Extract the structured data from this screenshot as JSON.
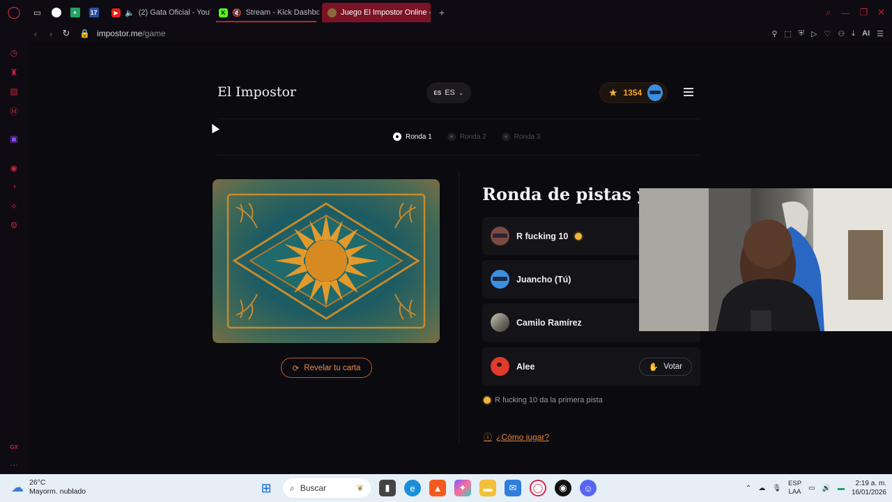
{
  "browser": {
    "tabs": [
      {
        "label": "(2) Gata Oficial - YouTu",
        "icon": "youtube-icon"
      },
      {
        "label": "Stream - Kick Dashboa",
        "icon": "kick-icon"
      },
      {
        "label": "Juego El Impostor Online -",
        "icon": "impostor-icon",
        "active": true
      }
    ],
    "url_host": "impostor.me",
    "url_path": "/game",
    "ai_label": "AI"
  },
  "site": {
    "title": "El Impostor",
    "lang_small": "ES",
    "lang": "ES",
    "score": "1354"
  },
  "rounds": [
    {
      "label": "Ronda 1",
      "active": true
    },
    {
      "label": "Ronda 2",
      "active": false
    },
    {
      "label": "Ronda 3",
      "active": false
    }
  ],
  "card": {
    "reveal_label": "Revelar tu carta"
  },
  "game": {
    "section_title": "Ronda de pistas y v",
    "players": [
      {
        "name": "R fucking 10",
        "avatar": "brown",
        "badge": true
      },
      {
        "name": "Juancho (Tú)",
        "avatar": "blue"
      },
      {
        "name": "Camilo Ramírez",
        "avatar": "photo"
      },
      {
        "name": "Alee",
        "avatar": "red",
        "vote_label": "Votar"
      }
    ],
    "clue_text": "R fucking 10 da la primera pista",
    "howto_label": "¿Cómo jugar?"
  },
  "taskbar": {
    "temp": "26°C",
    "weather": "Mayorm. nublado",
    "search": "Buscar",
    "lang_top": "ESP",
    "lang_bottom": "LAA",
    "time": "2:19 a. m.",
    "date": "16/01/2026"
  },
  "colors": {
    "accent": "#e8863a",
    "opera_red": "#c8243c",
    "score_gold": "#f5a623"
  }
}
